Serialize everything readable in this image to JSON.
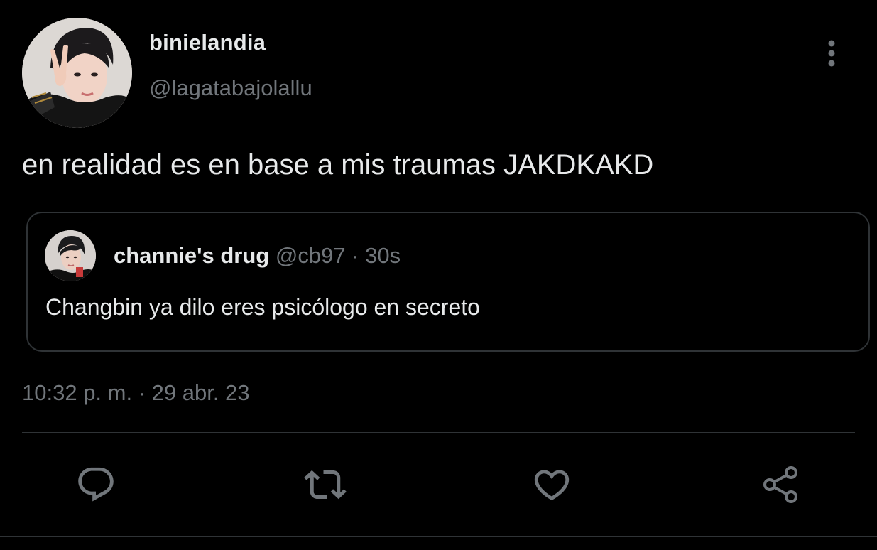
{
  "tweet": {
    "author": {
      "display_name": "binielandia",
      "handle": "@lagatabajolallu"
    },
    "text": "en realidad es en base a mis traumas JAKDKAKD",
    "timestamp": "10:32 p. m. · 29 abr. 23"
  },
  "quoted_tweet": {
    "display_name": "channie's drug",
    "handle": "@cb97",
    "separator": " · ",
    "time": "30s",
    "text": "Changbin ya dilo eres psicólogo en secreto"
  },
  "actions": {
    "reply_icon": "reply-icon",
    "retweet_icon": "retweet-icon",
    "like_icon": "heart-icon",
    "share_icon": "share-icon"
  },
  "colors": {
    "background": "#000000",
    "primary_text": "#e7e9ea",
    "secondary_text": "#71767b",
    "border": "#2f3336",
    "icon": "#71767b"
  }
}
